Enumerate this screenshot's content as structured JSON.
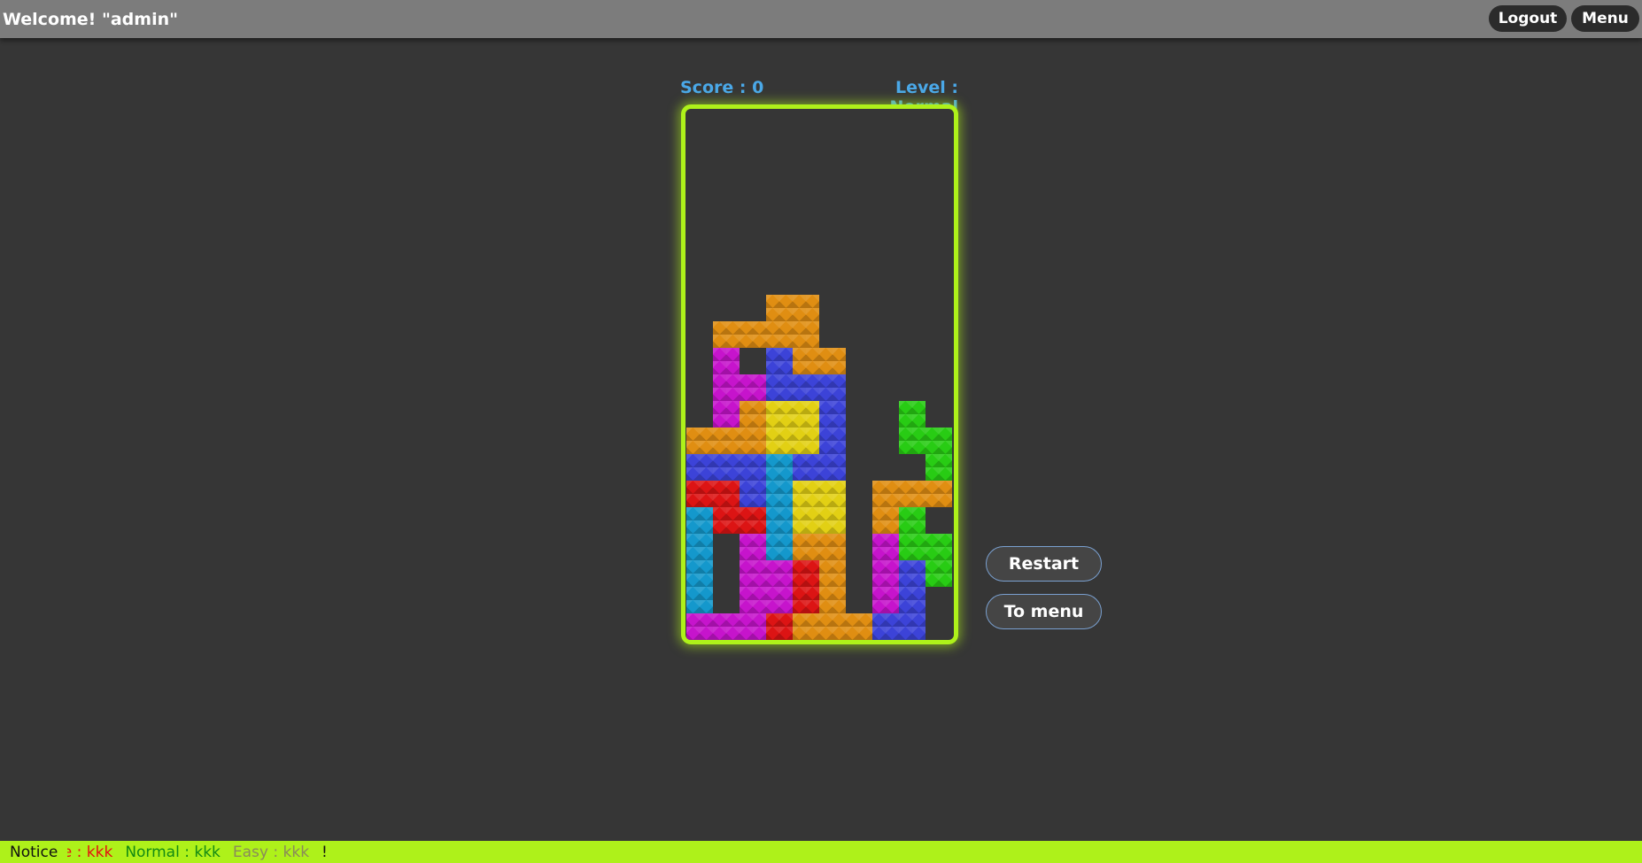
{
  "header": {
    "welcome": "Welcome! \"admin\"",
    "logout_label": "Logout",
    "menu_label": "Menu"
  },
  "hud": {
    "score": "Score : 0",
    "level": "Level : Normal"
  },
  "buttons": {
    "restart_label": "Restart",
    "to_menu_label": "To menu"
  },
  "notice": {
    "label": "Notice",
    "items": [
      {
        "text": "ne : kkk",
        "color": "#e41010"
      },
      {
        "text": "Normal : kkk",
        "color": "#138a13"
      },
      {
        "text": "Easy : kkk",
        "color": "#8a8a5a"
      },
      {
        "text": "!",
        "color": "#111111"
      }
    ]
  },
  "board": {
    "rows": 20,
    "cols": 10,
    "colors": {
      "O": "#e08e12",
      "P": "#c614cc",
      "B": "#3c43d8",
      "Y": "#e2d014",
      "C": "#1498cc",
      "R": "#dc1414",
      "G": "#28cc14"
    },
    "grid": [
      "..........",
      "..........",
      "..........",
      "..........",
      "..........",
      "..........",
      "..........",
      "...OO.....",
      ".OOOO.....",
      ".P.BOO....",
      ".PPBBB....",
      ".POYYB..G.",
      "OOOYYB..GG",
      "BBBCBB...G",
      "RRBCYY.OOO",
      "CRRCYY.OG.",
      "C.PCOO.PGG",
      "C.PPRO.PBG",
      "C.PPRO.PB.",
      "PPPROOOBB."
    ]
  }
}
